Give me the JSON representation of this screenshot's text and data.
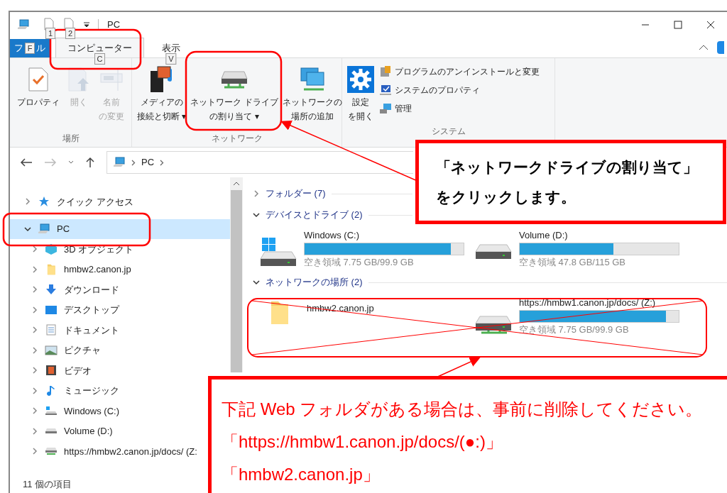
{
  "window": {
    "title": "PC",
    "quick_access_keytips": [
      "1",
      "2"
    ]
  },
  "ribbon_tabs": [
    {
      "kind": "file",
      "label_left": "フ",
      "keytip": "F",
      "label_right": "ル",
      "selected": false
    },
    {
      "kind": "tab",
      "label": "コンピューター",
      "keytip": "C",
      "selected": true
    },
    {
      "kind": "tab",
      "label": "表示",
      "keytip": "V",
      "selected": false
    }
  ],
  "ribbon_groups": [
    {
      "label": "場所",
      "items": [
        {
          "kind": "large",
          "lines": [
            "プロパティ"
          ],
          "disabled": false
        },
        {
          "kind": "large",
          "lines": [
            "開く"
          ],
          "disabled": true
        },
        {
          "kind": "large",
          "lines": [
            "名前",
            "の変更"
          ],
          "disabled": true
        }
      ]
    },
    {
      "label": "ネットワーク",
      "items": [
        {
          "kind": "large",
          "lines": [
            "メディアの",
            "接続と切断"
          ],
          "disabled": false,
          "caret": "▾"
        },
        {
          "kind": "large",
          "lines": [
            "ネットワーク ドライブ",
            "の割り当て"
          ],
          "disabled": false,
          "caret": "▾"
        },
        {
          "kind": "large",
          "lines": [
            "ネットワークの",
            "場所の追加"
          ],
          "disabled": false
        }
      ]
    },
    {
      "label": "システム",
      "items": [
        {
          "kind": "large",
          "lines": [
            "設定",
            "を開く"
          ],
          "disabled": false
        },
        {
          "kind": "small",
          "lines": [
            "プログラムのアンインストールと変更"
          ],
          "disabled": false
        },
        {
          "kind": "small",
          "lines": [
            "システムのプロパティ"
          ],
          "disabled": false
        },
        {
          "kind": "small",
          "lines": [
            "管理"
          ],
          "disabled": false
        }
      ]
    }
  ],
  "address_bar": {
    "path": [
      "PC"
    ]
  },
  "nav_tree": [
    {
      "label": "クイック アクセス",
      "expanded": false,
      "selected": false
    },
    {
      "label": "PC",
      "expanded": true,
      "selected": true,
      "children": [
        {
          "label": "3D オブジェクト",
          "expanded": false,
          "selected": false
        },
        {
          "label": "hmbw2.canon.jp",
          "expanded": false,
          "selected": false
        },
        {
          "label": "ダウンロード",
          "expanded": false,
          "selected": false
        },
        {
          "label": "デスクトップ",
          "expanded": false,
          "selected": false
        },
        {
          "label": "ドキュメント",
          "expanded": false,
          "selected": false
        },
        {
          "label": "ピクチャ",
          "expanded": false,
          "selected": false
        },
        {
          "label": "ビデオ",
          "expanded": false,
          "selected": false
        },
        {
          "label": "ミュージック",
          "expanded": false,
          "selected": false
        },
        {
          "label": "Windows (C:)",
          "expanded": false,
          "selected": false
        },
        {
          "label": "Volume (D:)",
          "expanded": false,
          "selected": false
        },
        {
          "label": "https://hmbw2.canon.jp/docs/ (Z:",
          "expanded": false,
          "selected": false
        }
      ]
    }
  ],
  "content_groups": [
    {
      "label": "フォルダー (7)",
      "expanded": false
    },
    {
      "label": "デバイスとドライブ (2)",
      "expanded": true,
      "items": [
        {
          "kind": "drive",
          "name": "Windows (C:)",
          "level": 0.92,
          "free": "空き領域 7.75 GB/99.9 GB"
        },
        {
          "kind": "drive",
          "name": "Volume (D:)",
          "level": 0.59,
          "free": "空き領域 47.8 GB/115 GB"
        }
      ]
    },
    {
      "label": "ネットワークの場所 (2)",
      "expanded": true,
      "items": [
        {
          "kind": "folder",
          "name": "hmbw2.canon.jp"
        },
        {
          "kind": "drive",
          "name": "https://hmbw1.canon.jp/docs/ (Z:)",
          "level": 0.92,
          "free": "空き領域 7.75 GB/99.9 GB"
        }
      ]
    }
  ],
  "status_bar": {
    "item_count": "11 個の項目"
  },
  "callouts": [
    {
      "lines": [
        "「ネットワークドライブの割り当て」",
        "をクリックします。"
      ]
    },
    {
      "lines": [
        "下記 Web フォルダがある場合は、事前に削除してください。",
        "「https://hmbw1.canon.jp/docs/(●:)」",
        "「hmbw2.canon.jp」"
      ]
    }
  ]
}
